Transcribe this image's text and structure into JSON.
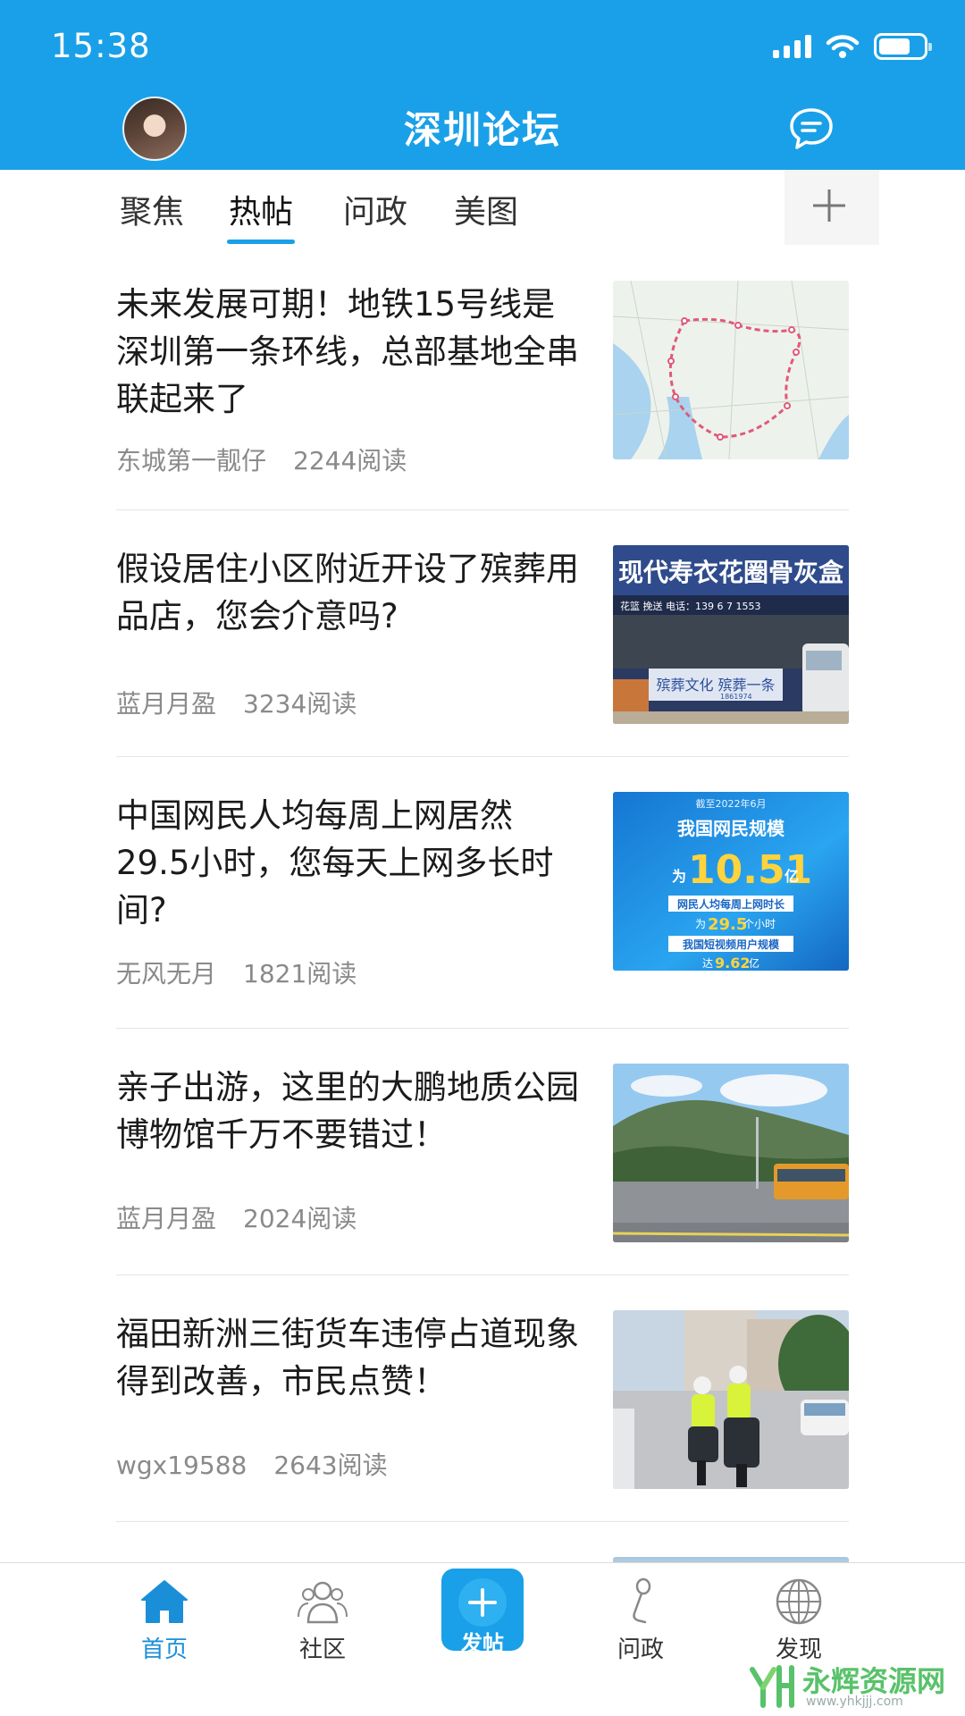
{
  "status_bar": {
    "time": "15:38"
  },
  "header": {
    "title": "深圳论坛"
  },
  "tabs": [
    {
      "label": "聚焦"
    },
    {
      "label": "热帖",
      "active": true
    },
    {
      "label": "问政"
    },
    {
      "label": "美图"
    }
  ],
  "feed": [
    {
      "title": "未来发展可期！地铁15号线是深圳第一条环线，总部基地全串联起来了",
      "author": "东城第一靓仔",
      "reads": "2244阅读"
    },
    {
      "title": "假设居住小区附近开设了殡葬用品店，您会介意吗?",
      "author": "蓝月月盈",
      "reads": "3234阅读",
      "thumb_text": {
        "sign": "现代寿衣花圈骨灰盒",
        "phone": "花篮 挽送 电话：139 6 7 1553",
        "banner": "殡葬文化 殡葬一条",
        "phone2": "1861974"
      }
    },
    {
      "title": "中国网民人均每周上网居然29.5小时，您每天上网多长时间?",
      "author": "无风无月",
      "reads": "1821阅读",
      "thumb_text": {
        "date": "截至2022年6月",
        "headline": "我国网民规模",
        "prefix": "为",
        "number": "10.51",
        "unit": "亿",
        "line1": "网民人均每周上网时长",
        "line2a": "为",
        "line2b": "29.5",
        "line2c": "个小时",
        "line3": "我国短视频用户规模",
        "line4a": "达",
        "line4b": "9.62",
        "line4c": "亿"
      }
    },
    {
      "title": "亲子出游，这里的大鹏地质公园博物馆千万不要错过！",
      "author": "蓝月月盈",
      "reads": "2024阅读"
    },
    {
      "title": "福田新洲三街货车违停占道现象得到改善，市民点赞！",
      "author": "wgx19588",
      "reads": "2643阅读"
    }
  ],
  "bottom_nav": {
    "home": "首页",
    "community": "社区",
    "post": "发帖",
    "politics": "问政",
    "discover": "发现"
  },
  "watermark": {
    "name": "永辉资源网",
    "url": "www.yhkjjj.com"
  },
  "colors": {
    "brand": "#1aa0e8",
    "nav_active": "#1a8fd8"
  }
}
